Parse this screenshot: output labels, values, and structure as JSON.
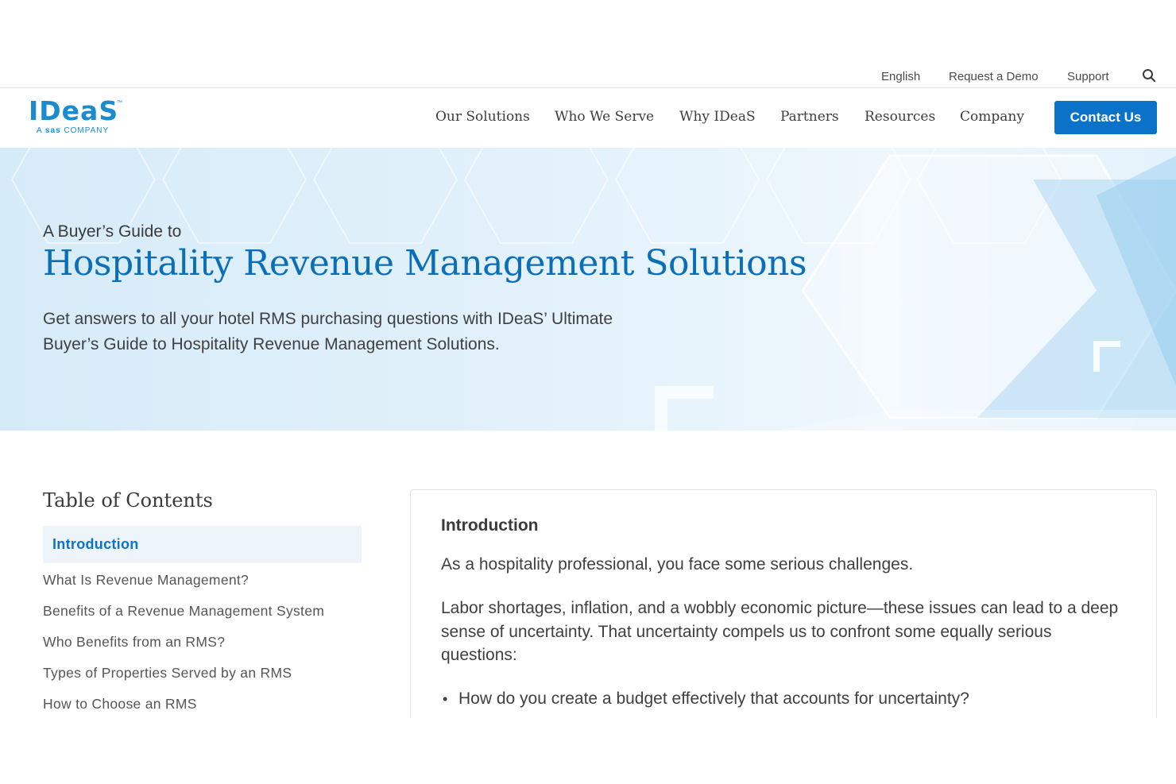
{
  "utility": {
    "language": "English",
    "request_demo": "Request a Demo",
    "support": "Support",
    "search_icon": "search-icon"
  },
  "logo": {
    "word": "IDeaS",
    "tm": "™",
    "sub_prefix": "A ",
    "sub_brand": "sas",
    "sub_suffix": " COMPANY"
  },
  "nav": {
    "items": [
      {
        "label": "Our Solutions"
      },
      {
        "label": "Who We Serve"
      },
      {
        "label": "Why IDeaS"
      },
      {
        "label": "Partners"
      },
      {
        "label": "Resources"
      },
      {
        "label": "Company"
      }
    ],
    "contact_label": "Contact Us"
  },
  "hero": {
    "kicker": "A Buyer’s Guide to",
    "title": "Hospitality Revenue Management Solutions",
    "description": "Get answers to all your hotel RMS purchasing questions with IDeaS’ Ultimate Buyer’s Guide to Hospitality Revenue Management Solutions."
  },
  "toc": {
    "title": "Table of Contents",
    "items": [
      {
        "label": "Introduction"
      },
      {
        "label": "What Is Revenue Management?"
      },
      {
        "label": "Benefits of a Revenue Management System"
      },
      {
        "label": "Who Benefits from an RMS?"
      },
      {
        "label": "Types of Properties Served by an RMS"
      },
      {
        "label": "How to Choose an RMS"
      }
    ]
  },
  "content": {
    "heading": "Introduction",
    "p1": "As a hospitality professional, you face some serious challenges.",
    "p2": "Labor shortages, inflation, and a wobbly economic picture—these issues can lead to a deep sense of uncertainty. That uncertainty compels us to confront some equally serious questions:",
    "bullets": [
      {
        "text": "How do you create a budget effectively that accounts for uncertainty?"
      }
    ]
  },
  "colors": {
    "accent": "#0a73c9",
    "title_blue": "#0a6fb8",
    "logo_blue": "#1b8bd0",
    "toc_active_bg": "#edf5fb"
  }
}
